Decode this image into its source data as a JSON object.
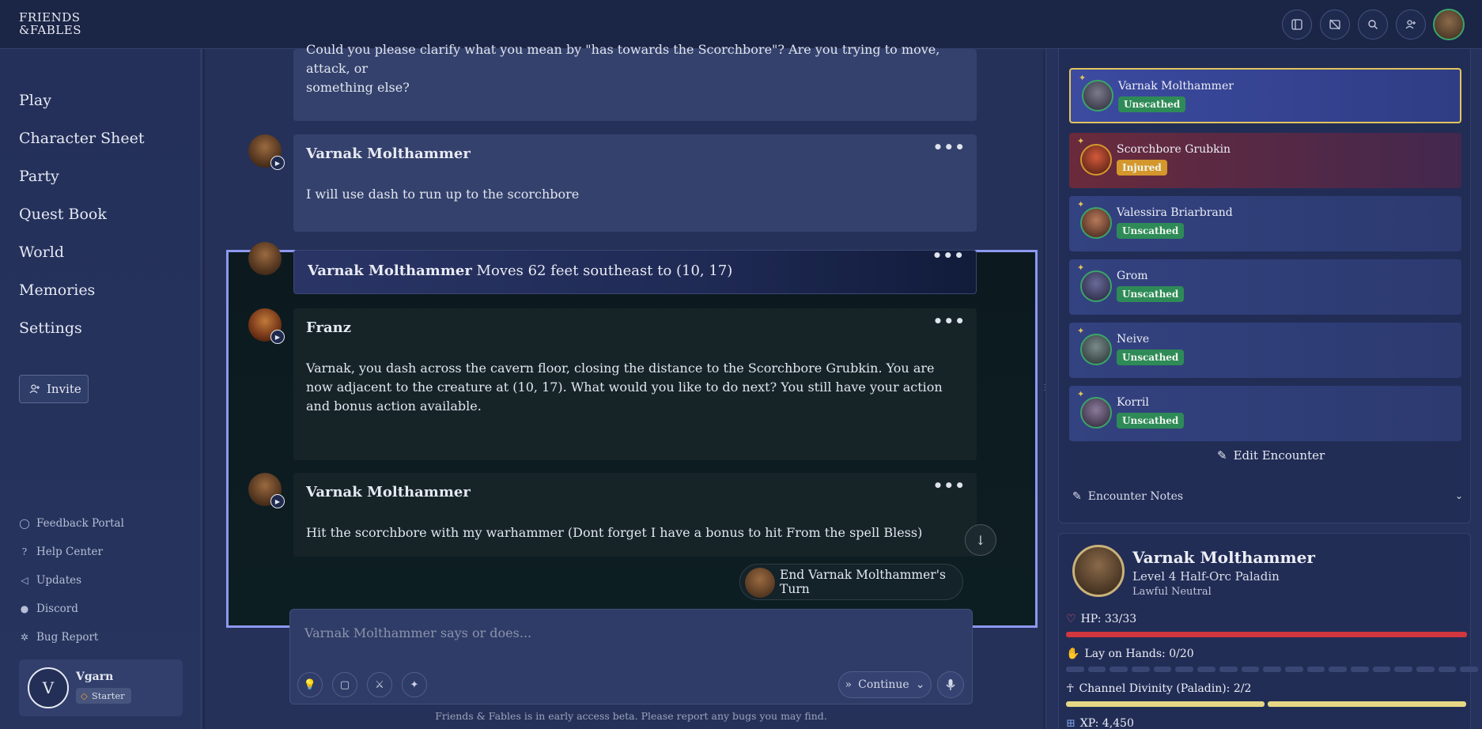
{
  "app": {
    "logo_line1": "FRIENDS",
    "logo_line2": "&FABLES"
  },
  "header": {
    "icons": [
      "sidebar-toggle-icon",
      "image-off-icon",
      "search-icon",
      "add-user-icon"
    ]
  },
  "sidebar": {
    "nav": [
      "Play",
      "Character Sheet",
      "Party",
      "Quest Book",
      "World",
      "Memories",
      "Settings"
    ],
    "invite_label": "Invite",
    "footer_links": [
      "Feedback Portal",
      "Help Center",
      "Updates",
      "Discord",
      "Bug Report"
    ],
    "user": {
      "initial": "V",
      "name": "Vgarn",
      "tier": "Starter"
    }
  },
  "chat": {
    "partial_message": {
      "line1": "Could you please clarify what you mean by \"has towards the Scorchbore\"? Are you trying to move, attack, or",
      "line2": "something else?"
    },
    "messages": [
      {
        "author": "Varnak Molthammer",
        "text": "I will use dash to run up to the scorchbore"
      },
      {
        "author": "Varnak Molthammer",
        "action": "Moves 62 feet southeast to (10, 17)"
      },
      {
        "author": "Franz",
        "text": "Varnak, you dash across the cavern floor, closing the distance to the Scorchbore Grubkin. You are now adjacent to the creature at (10, 17). What would you like to do next? You still have your action and bonus action available."
      },
      {
        "author": "Varnak Molthammer",
        "text": "Hit the scorchbore with my warhammer (Dont forget I have a bonus to hit From the spell Bless)"
      }
    ],
    "end_turn_label": "End Varnak Molthammer's Turn",
    "input_placeholder": "Varnak Molthammer says or does...",
    "continue_label": "Continue",
    "disclaimer": "Friends & Fables is in early access beta. Please report any bugs you may find."
  },
  "encounter": {
    "combatants": [
      {
        "name": "Varnak Molthammer",
        "status": "Unscathed",
        "active": true
      },
      {
        "name": "Scorchbore Grubkin",
        "status": "Injured",
        "active": false
      },
      {
        "name": "Valessira Briarbrand",
        "status": "Unscathed",
        "active": false
      },
      {
        "name": "Grom",
        "status": "Unscathed",
        "active": false
      },
      {
        "name": "Neive",
        "status": "Unscathed",
        "active": false
      },
      {
        "name": "Korril",
        "status": "Unscathed",
        "active": false
      }
    ],
    "edit_label": "Edit Encounter",
    "notes_label": "Encounter Notes"
  },
  "character": {
    "name": "Varnak Molthammer",
    "level": "Level 4 Half-Orc Paladin",
    "alignment": "Lawful Neutral",
    "hp": "HP: 33/33",
    "hp_fraction": 1.0,
    "lay_on_hands": "Lay on Hands: 0/20",
    "lay_on_hands_fraction": 0.0,
    "channel_divinity": "Channel Divinity (Paladin): 2/2",
    "xp": "XP: 4,450"
  },
  "colors": {
    "accent_border": "#8d98f0",
    "unscathed": "#2e8b57",
    "injured": "#d4972c",
    "hp_bar": "#d2363e",
    "divinity_bar": "#e5d786",
    "active_card_border": "#e2c45c"
  }
}
